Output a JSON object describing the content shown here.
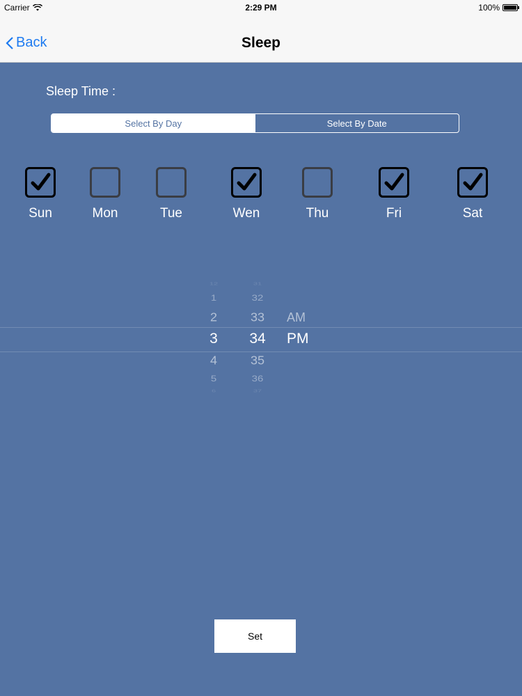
{
  "status_bar": {
    "carrier": "Carrier",
    "time": "2:29 PM",
    "battery": "100%"
  },
  "nav": {
    "back_label": "Back",
    "title": "Sleep"
  },
  "sleep_time_label": "Sleep Time :",
  "segments": [
    {
      "label": "Select By Day",
      "selected": true
    },
    {
      "label": "Select By Date",
      "selected": false
    }
  ],
  "days": [
    {
      "label": "Sun",
      "checked": true
    },
    {
      "label": "Mon",
      "checked": false
    },
    {
      "label": "Tue",
      "checked": false
    },
    {
      "label": "Wen",
      "checked": true
    },
    {
      "label": "Thu",
      "checked": false
    },
    {
      "label": "Fri",
      "checked": true
    },
    {
      "label": "Sat",
      "checked": true
    }
  ],
  "picker": {
    "hours": [
      "12",
      "1",
      "2",
      "3",
      "4",
      "5",
      "6"
    ],
    "minutes": [
      "31",
      "32",
      "33",
      "34",
      "35",
      "36",
      "37"
    ],
    "ampm": [
      "AM",
      "PM"
    ],
    "selected_hour": "3",
    "selected_minute": "34",
    "selected_ampm": "PM"
  },
  "set_button": "Set",
  "colors": {
    "background": "#5473A3",
    "accent": "#1E7BF0"
  }
}
